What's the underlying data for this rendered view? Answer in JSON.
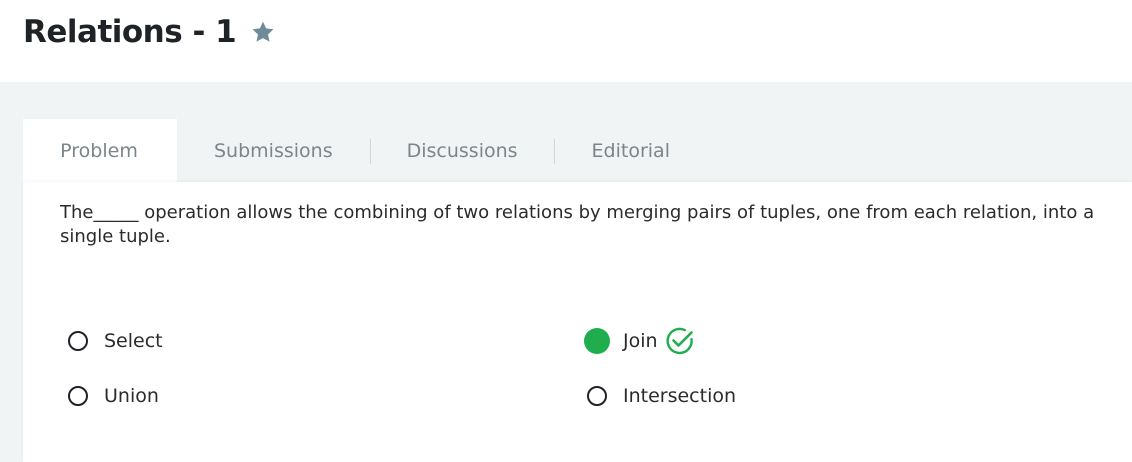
{
  "header": {
    "title": "Relations - 1",
    "star_icon": "star-icon"
  },
  "tabs": [
    {
      "label": "Problem",
      "active": true
    },
    {
      "label": "Submissions",
      "active": false
    },
    {
      "label": "Discussions",
      "active": false
    },
    {
      "label": "Editorial",
      "active": false
    }
  ],
  "problem": {
    "question": "The_____ operation allows the combining of two relations by merging pairs of tuples, one from each relation, into a single tuple.",
    "options": [
      {
        "label": "Select",
        "selected": false,
        "correct": false
      },
      {
        "label": "Join",
        "selected": true,
        "correct": true
      },
      {
        "label": "Union",
        "selected": false,
        "correct": false
      },
      {
        "label": "Intersection",
        "selected": false,
        "correct": false
      }
    ]
  },
  "colors": {
    "background_band": "#f1f4f5",
    "tab_text": "#7b858a",
    "selected_radio": "#1fad4e",
    "correct_check": "#1fad4e",
    "star": "#6f8b97"
  }
}
